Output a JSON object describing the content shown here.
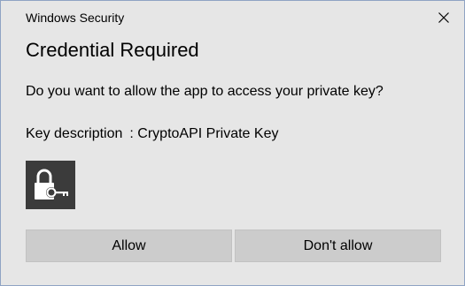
{
  "window": {
    "title": "Windows Security",
    "close_icon": "close-icon"
  },
  "dialog": {
    "heading": "Credential Required",
    "question": "Do you want to allow the app to access your private key?",
    "key_label": "Key description",
    "key_separator": ":",
    "key_value": "CryptoAPI Private Key",
    "key_icon": "lock-key-icon"
  },
  "buttons": {
    "allow_label": "Allow",
    "deny_label": "Don't allow"
  },
  "colors": {
    "dialog_background": "#e6e6e6",
    "button_background": "#cccccc",
    "icon_tile": "#3b3b3b"
  }
}
